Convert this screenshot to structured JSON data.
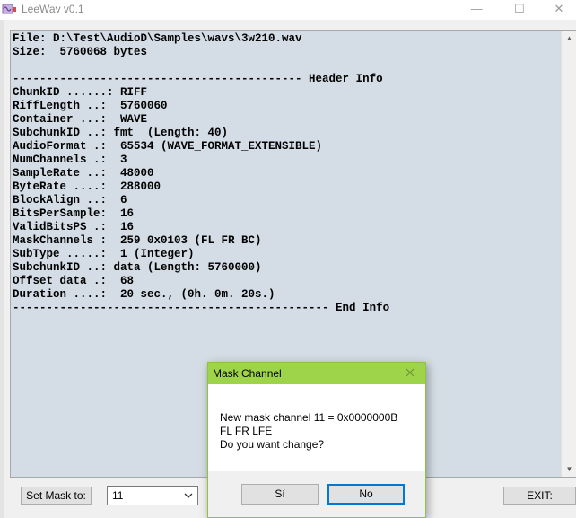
{
  "window": {
    "title": "LeeWav v0.1",
    "minimize_glyph": "—",
    "maximize_glyph": "☐",
    "close_glyph": "✕",
    "icon": "wave-app-icon"
  },
  "output": {
    "lines": [
      "File: D:\\Test\\AudioD\\Samples\\wavs\\3w210.wav",
      "Size:  5760068 bytes",
      "",
      "------------------------------------------- Header Info",
      "ChunkID ......: RIFF",
      "RiffLength ..:  5760060",
      "Container ...:  WAVE",
      "SubchunkID ..: fmt  (Length: 40)",
      "AudioFormat .:  65534 (WAVE_FORMAT_EXTENSIBLE)",
      "NumChannels .:  3",
      "SampleRate ..:  48000",
      "ByteRate ....:  288000",
      "BlockAlign ..:  6",
      "BitsPerSample:  16",
      "ValidBitsPS .:  16",
      "MaskChannels :  259 0x0103 (FL FR BC)",
      "SubType .....:  1 (Integer)",
      "SubchunkID ..: data (Length: 5760000)",
      "Offset data .:  68",
      "Duration ....:  20 sec., (0h. 0m. 20s.)",
      "----------------------------------------------- End Info"
    ]
  },
  "controls": {
    "set_mask_label": "Set Mask to:",
    "mask_value": "11",
    "exit_label": "EXIT:"
  },
  "dialog": {
    "title": "Mask Channel",
    "message": [
      "New mask channel 11 = 0x0000000B",
      "FL FR LFE",
      "Do you want change?"
    ],
    "yes_label": "Sí",
    "no_label": "No",
    "accent_color": "#9ed449"
  },
  "colors": {
    "text_area_bg": "#d4dde5",
    "dialog_border": "#8fc23f"
  }
}
